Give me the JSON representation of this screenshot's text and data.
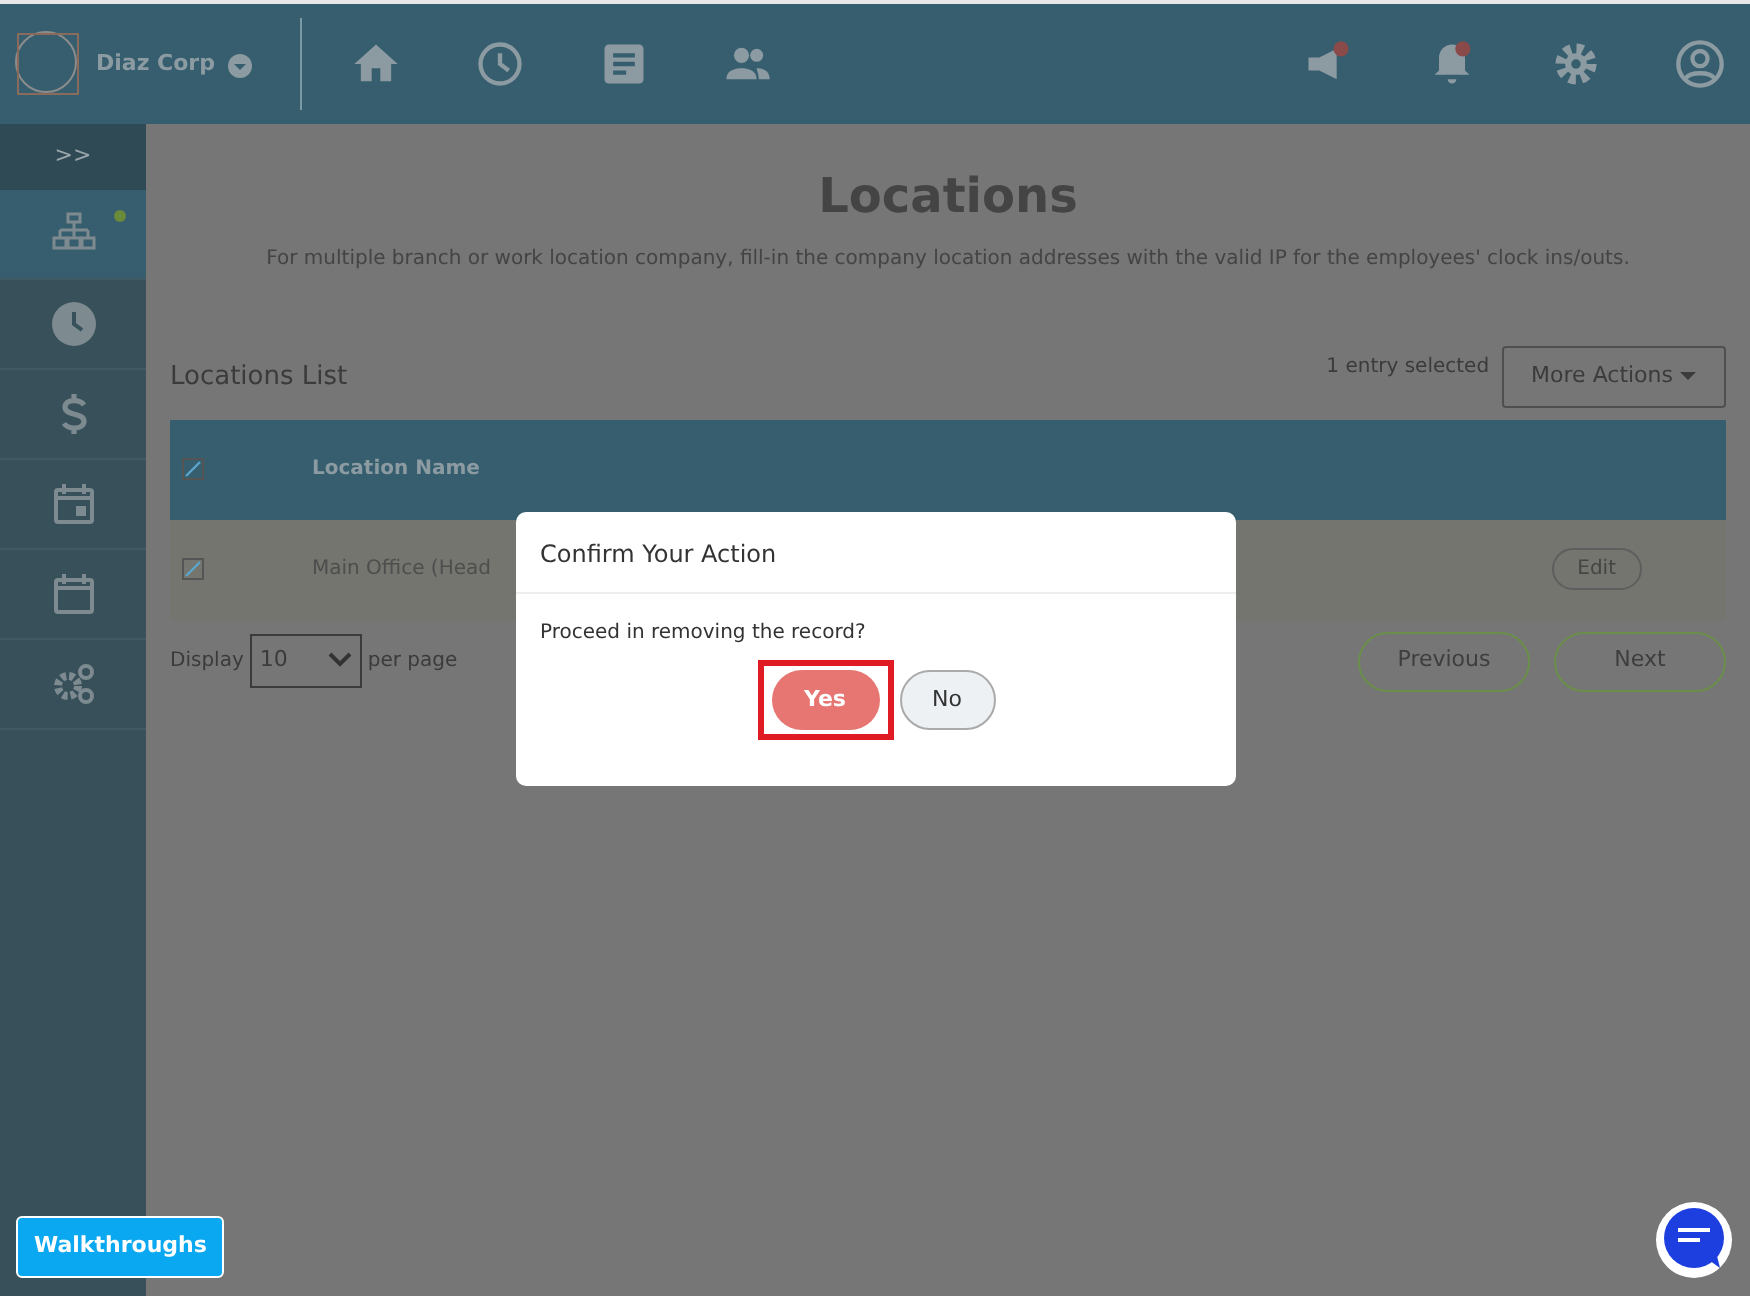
{
  "header": {
    "company": "Diaz Corp"
  },
  "sidebar": {
    "toggle": ">>",
    "items": [
      {
        "selected": true
      },
      {
        "selected": false
      },
      {
        "selected": false
      },
      {
        "selected": false
      },
      {
        "selected": false
      },
      {
        "selected": false
      }
    ]
  },
  "page": {
    "title": "Locations",
    "subtitle": "For multiple branch or work location company, fill-in the company location addresses with the valid IP for the employees' clock ins/outs."
  },
  "list": {
    "title": "Locations List",
    "selection_info": "1 entry selected",
    "actions_button": "More Actions"
  },
  "table": {
    "all_checked": true,
    "columns": [
      "Location Name"
    ],
    "rows": [
      {
        "checked": true,
        "cells": [
          "Main Office (Head"
        ],
        "action": "Edit"
      }
    ]
  },
  "pager": {
    "display_label": "Display",
    "page_size": "10",
    "per_page_label": "per page",
    "previous": "Previous",
    "next": "Next"
  },
  "dialog": {
    "title": "Confirm Your Action",
    "message": "Proceed in removing the record?",
    "confirm": "Yes",
    "cancel": "No"
  },
  "walkthroughs": "Walkthroughs"
}
